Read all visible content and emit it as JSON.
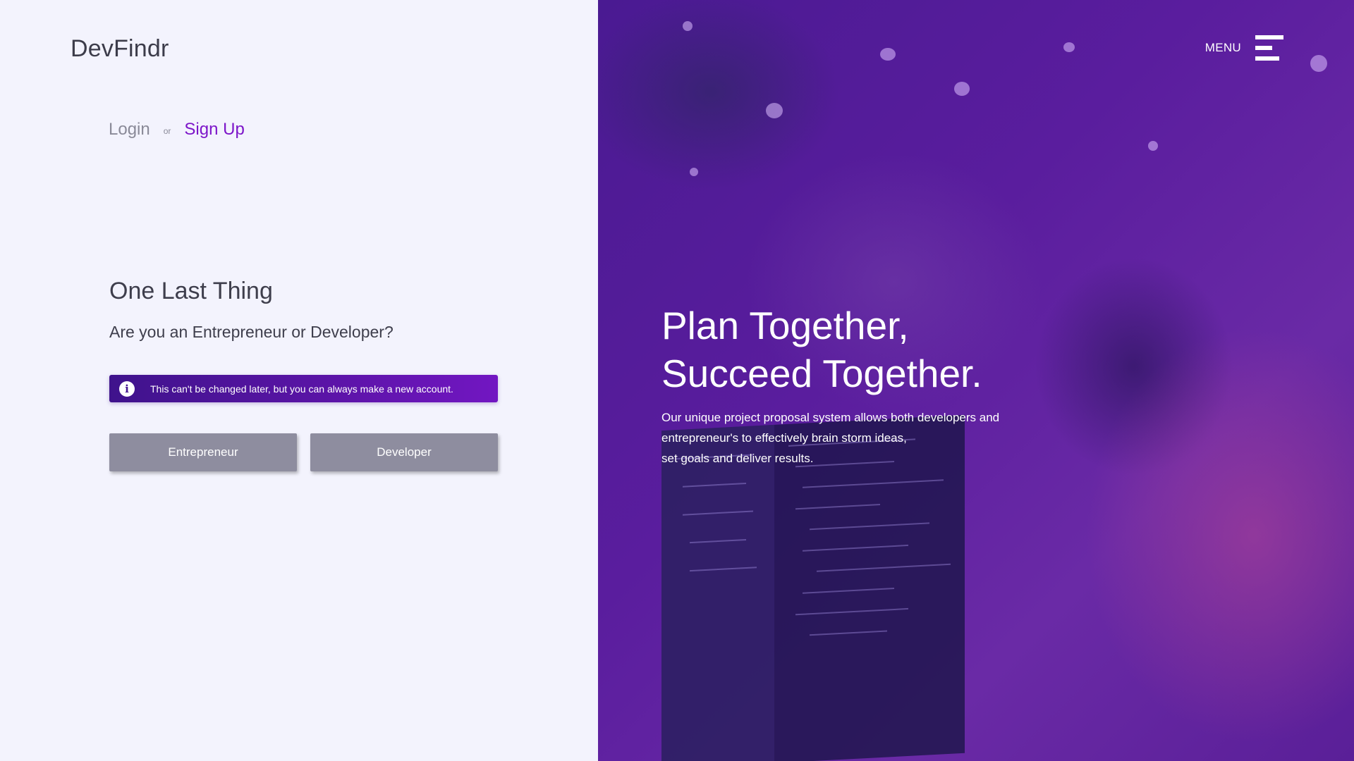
{
  "brand": "DevFindr",
  "auth": {
    "login": "Login",
    "or": "or",
    "signup": "Sign Up"
  },
  "onboarding": {
    "heading": "One Last Thing",
    "question": "Are you an Entrepreneur or Developer?",
    "notice": "This can't be changed later, but you can always make a new account.",
    "buttons": {
      "entrepreneur": "Entrepreneur",
      "developer": "Developer"
    }
  },
  "menu": {
    "label": "MENU"
  },
  "hero": {
    "line1": "Plan Together,",
    "line2": "Succeed Together.",
    "desc1": "Our unique project proposal system allows both developers and",
    "desc2": "entrepreneur's to effectively brain storm ideas,",
    "desc3": "set goals and deliver results."
  },
  "icons": {
    "info": "info-circle-icon",
    "menu": "hamburger-menu-icon"
  },
  "colors": {
    "accent": "#7d16c9",
    "notice_start": "#3f138c",
    "notice_end": "#7216c2",
    "button": "#8e8d9f",
    "panel_bg": "#f3f3fd",
    "hero_overlay": "#5a1d9e"
  }
}
